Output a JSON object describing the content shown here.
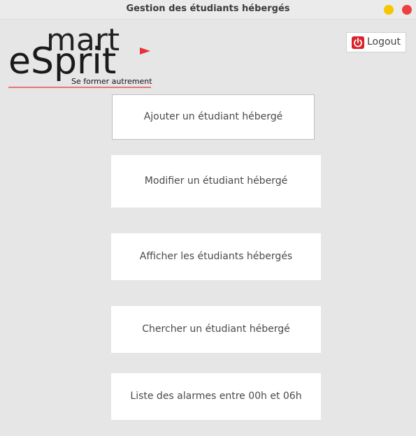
{
  "window": {
    "title": "Gestion des étudiants hébergés"
  },
  "logo": {
    "brand_top": "mart",
    "brand_bottom": "eSprit",
    "tagline": "Se former autrement",
    "accent_color": "#e8303a"
  },
  "header": {
    "logout_label": "Logout",
    "logout_icon": "power-icon"
  },
  "menu": {
    "buttons": [
      {
        "label": "Ajouter un étudiant hébergé"
      },
      {
        "label": "Modifier un étudiant hébergé"
      },
      {
        "label": "Afficher les étudiants hébergés"
      },
      {
        "label": "Chercher un étudiant hébergé"
      },
      {
        "label": "Liste des alarmes entre 00h et 06h"
      }
    ]
  }
}
